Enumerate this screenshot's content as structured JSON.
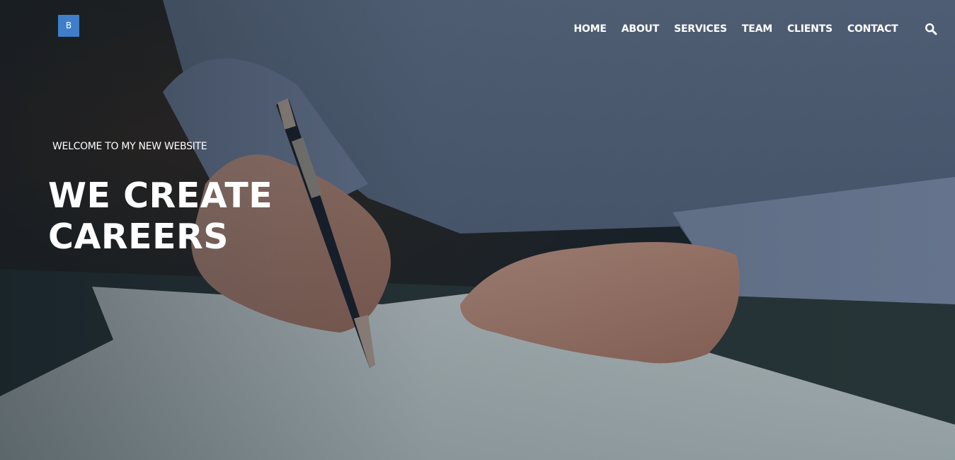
{
  "header": {
    "logo_text": "B",
    "nav": [
      {
        "label": "HOME"
      },
      {
        "label": "ABOUT"
      },
      {
        "label": "SERVICES"
      },
      {
        "label": "TEAM"
      },
      {
        "label": "CLIENTS"
      },
      {
        "label": "CONTACT"
      }
    ],
    "search_icon": "search-icon"
  },
  "hero": {
    "eyebrow": "WELCOME TO MY NEW WEBSITE",
    "headline_line1": "WE CREATE",
    "headline_line2": "CAREERS",
    "background": "photo of a man signing a document with a pen"
  },
  "colors": {
    "logo_bg": "#3f7fca",
    "text": "#ffffff"
  }
}
